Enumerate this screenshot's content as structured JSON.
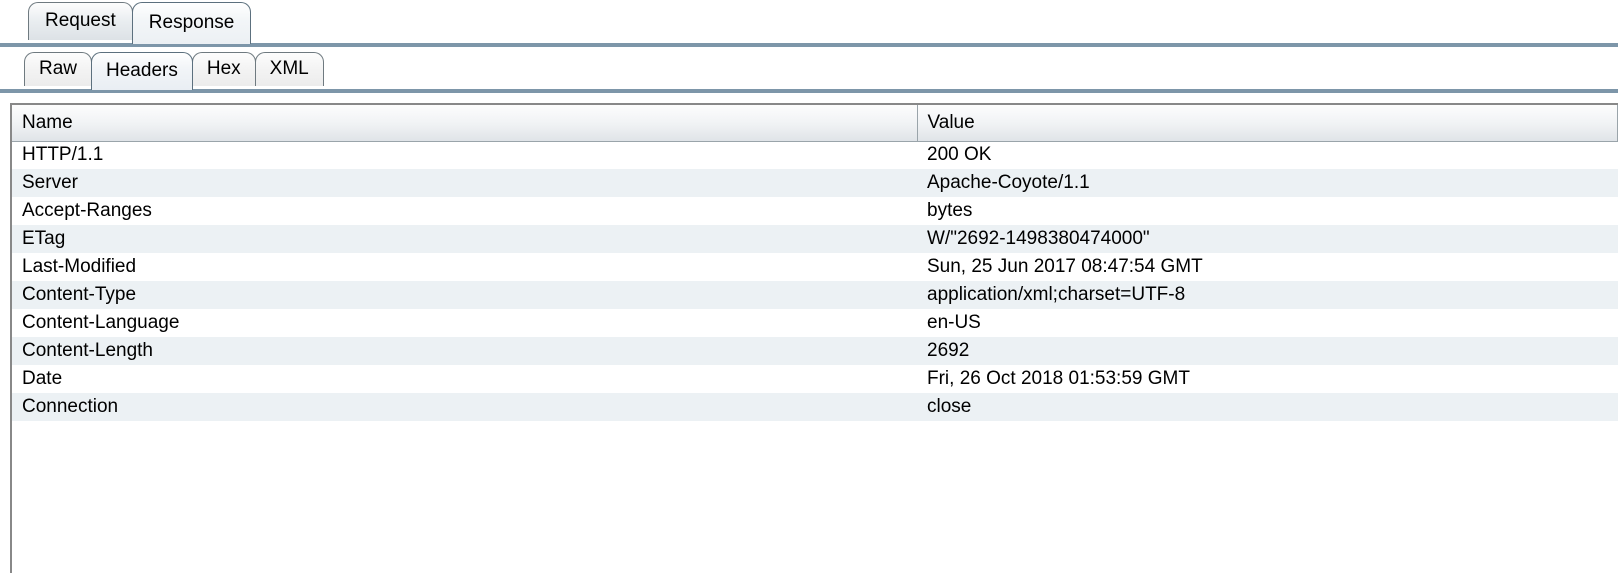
{
  "top_tabs": {
    "request": "Request",
    "response": "Response",
    "active": "response"
  },
  "sub_tabs": {
    "raw": "Raw",
    "headers": "Headers",
    "hex": "Hex",
    "xml": "XML",
    "active": "headers"
  },
  "table": {
    "columns": {
      "name": "Name",
      "value": "Value"
    },
    "rows": [
      {
        "name": "HTTP/1.1",
        "value": "200 OK"
      },
      {
        "name": "Server",
        "value": "Apache-Coyote/1.1"
      },
      {
        "name": "Accept-Ranges",
        "value": "bytes"
      },
      {
        "name": "ETag",
        "value": "W/\"2692-1498380474000\""
      },
      {
        "name": "Last-Modified",
        "value": "Sun, 25 Jun 2017 08:47:54 GMT"
      },
      {
        "name": "Content-Type",
        "value": "application/xml;charset=UTF-8"
      },
      {
        "name": "Content-Language",
        "value": "en-US"
      },
      {
        "name": "Content-Length",
        "value": "2692"
      },
      {
        "name": "Date",
        "value": "Fri, 26 Oct 2018 01:53:59 GMT"
      },
      {
        "name": "Connection",
        "value": "close"
      }
    ]
  }
}
